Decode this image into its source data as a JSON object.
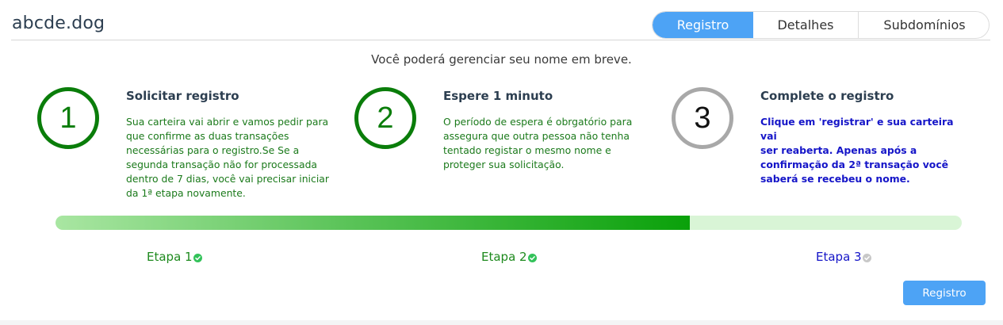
{
  "header": {
    "domain": "abcde.dog",
    "tabs": [
      {
        "label": "Registro",
        "active": true
      },
      {
        "label": "Detalhes",
        "active": false
      },
      {
        "label": "Subdomínios",
        "active": false
      }
    ]
  },
  "subtitle": "Você poderá gerenciar seu nome em breve.",
  "steps": [
    {
      "number": "1",
      "title": "Solicitar registro",
      "lines": [
        "Sua carteira vai abrir e vamos pedir para",
        "que confirme as duas transações",
        "necessárias para o registro.Se Se a",
        "segunda transação não for processada",
        "dentro de 7 dias, você vai precisar iniciar",
        "da 1ª etapa novamente."
      ],
      "status": "done"
    },
    {
      "number": "2",
      "title": "Espere 1 minuto",
      "lines": [
        "O período de espera é obrgatório para",
        "assegura que outra pessoa não tenha",
        "tentado registar o mesmo nome e",
        "proteger sua solicitação."
      ],
      "status": "done"
    },
    {
      "number": "3",
      "title": "Complete o registro",
      "lines": [
        "Clique em 'registrar' e sua carteira vai",
        "ser reaberta. Apenas após a",
        "confirmação da 2ª transação você",
        "saberá se recebeu o nome."
      ],
      "status": "pending"
    }
  ],
  "progress": {
    "fraction": 0.7
  },
  "etapas": [
    {
      "label": "Etapa 1",
      "status": "done",
      "icon": "check-circle-icon"
    },
    {
      "label": "Etapa 2",
      "status": "done",
      "icon": "check-circle-icon"
    },
    {
      "label": "Etapa 3",
      "status": "pending",
      "icon": "check-circle-icon"
    }
  ],
  "button": {
    "label": "Registro"
  },
  "colors": {
    "accent": "#4da3f5",
    "done_green": "#0a7d0a",
    "pending_blue": "#1515c8",
    "pending_gray": "#a8a8a8"
  }
}
